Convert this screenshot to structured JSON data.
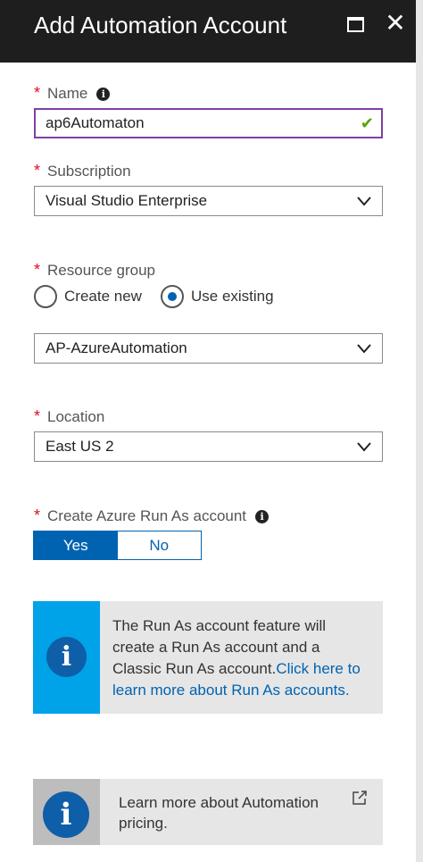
{
  "header": {
    "title": "Add Automation Account",
    "maximize_icon": "maximize-icon",
    "close_icon": "close-icon",
    "close_glyph": "✕"
  },
  "form": {
    "required_marker": "*",
    "name": {
      "label": "Name",
      "value": "ap6Automaton",
      "valid_glyph": "✔"
    },
    "subscription": {
      "label": "Subscription",
      "selected": "Visual Studio Enterprise"
    },
    "resource_group": {
      "label": "Resource group",
      "options": [
        "Create new",
        "Use existing"
      ],
      "selected_option": "Use existing",
      "selected": "AP-AzureAutomation"
    },
    "location": {
      "label": "Location",
      "selected": "East US 2"
    },
    "run_as": {
      "label": "Create Azure Run As account",
      "yes": "Yes",
      "no": "No",
      "selected": "Yes"
    }
  },
  "info_runas": {
    "text": "The Run As account feature will create a Run As account and a Classic Run As account.",
    "link": "Click here to learn more about Run As accounts."
  },
  "info_pricing": {
    "text": "Learn more about Automation pricing."
  },
  "icon_glyph": "i",
  "colors": {
    "accent": "#0063b1",
    "required": "#e00b1c",
    "valid_check": "#57a300",
    "focus_border": "#7f3fa6",
    "info_side": "#00a2e8",
    "pricing_side": "#bdbdbd"
  }
}
